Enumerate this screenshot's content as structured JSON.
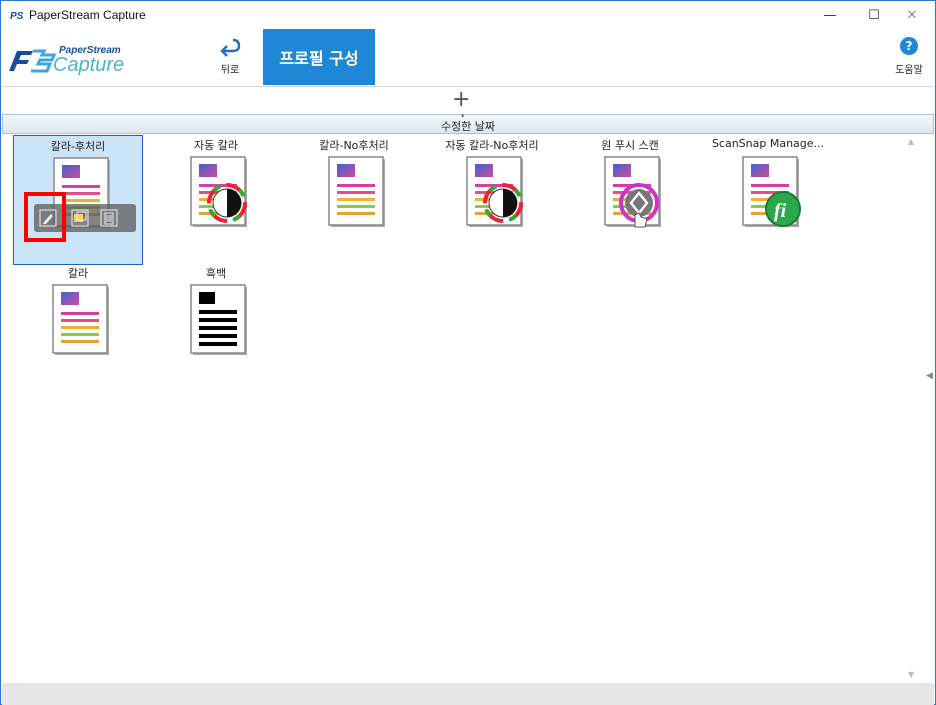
{
  "window": {
    "title": "PaperStream Capture",
    "minimize": "—",
    "maximize": "☐",
    "close": "✕"
  },
  "logo": {
    "top": "PaperStream",
    "bottom": "Capture"
  },
  "toolbar": {
    "back_label": "뒤로",
    "profile_tab": "프로필 구성",
    "help_label": "도움말",
    "help_glyph": "?"
  },
  "addbar": {
    "plus": "+"
  },
  "sort": {
    "label": "수정한 날짜"
  },
  "profiles": [
    {
      "name": "칼라-후처리",
      "type": "color",
      "selected": true
    },
    {
      "name": "자동 칼라",
      "type": "auto-color",
      "selected": false
    },
    {
      "name": "칼라-No후처리",
      "type": "color",
      "selected": false
    },
    {
      "name": "자동 칼라-No후처리",
      "type": "auto-color",
      "selected": false
    },
    {
      "name": "원 푸시 스캔",
      "type": "one-push",
      "selected": false
    },
    {
      "name": "ScanSnap Manage...",
      "type": "scansnap",
      "selected": false
    },
    {
      "name": "칼라",
      "type": "color",
      "selected": false
    },
    {
      "name": "흑백",
      "type": "mono",
      "selected": false
    }
  ],
  "hover_actions": [
    "edit-icon",
    "copy-icon",
    "delete-icon"
  ],
  "colors": {
    "accent": "#1e88d6",
    "selection": "#cce4f7",
    "highlight": "#ff0000"
  }
}
